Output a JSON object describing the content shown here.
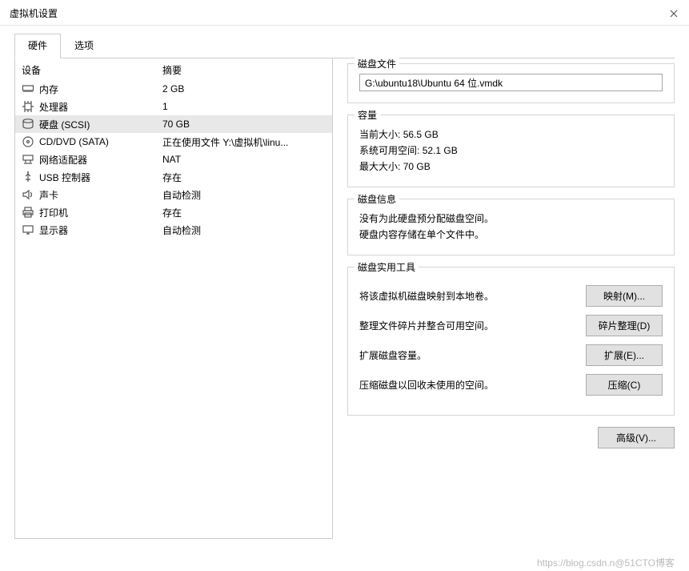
{
  "title": "虚拟机设置",
  "tabs": {
    "hardware": "硬件",
    "options": "选项"
  },
  "hwHeader": {
    "device": "设备",
    "summary": "摘要"
  },
  "hwItems": [
    {
      "icon": "memory",
      "name": "内存",
      "summary": "2 GB"
    },
    {
      "icon": "cpu",
      "name": "处理器",
      "summary": "1"
    },
    {
      "icon": "disk",
      "name": "硬盘 (SCSI)",
      "summary": "70 GB"
    },
    {
      "icon": "disc",
      "name": "CD/DVD (SATA)",
      "summary": "正在使用文件 Y:\\虚拟机\\linu..."
    },
    {
      "icon": "net",
      "name": "网络适配器",
      "summary": "NAT"
    },
    {
      "icon": "usb",
      "name": "USB 控制器",
      "summary": "存在"
    },
    {
      "icon": "sound",
      "name": "声卡",
      "summary": "自动检测"
    },
    {
      "icon": "printer",
      "name": "打印机",
      "summary": "存在"
    },
    {
      "icon": "display",
      "name": "显示器",
      "summary": "自动检测"
    }
  ],
  "diskFile": {
    "legend": "磁盘文件",
    "value": "G:\\ubuntu18\\Ubuntu 64 位.vmdk"
  },
  "capacity": {
    "legend": "容量",
    "currentLabel": "当前大小:",
    "currentValue": "56.5 GB",
    "freeLabel": "系统可用空间:",
    "freeValue": "52.1 GB",
    "maxLabel": "最大大小:",
    "maxValue": "70 GB"
  },
  "diskInfo": {
    "legend": "磁盘信息",
    "line1": "没有为此硬盘预分配磁盘空间。",
    "line2": "硬盘内容存储在单个文件中。"
  },
  "utilities": {
    "legend": "磁盘实用工具",
    "mapDesc": "将该虚拟机磁盘映射到本地卷。",
    "mapBtn": "映射(M)...",
    "defragDesc": "整理文件碎片并整合可用空间。",
    "defragBtn": "碎片整理(D)",
    "expandDesc": "扩展磁盘容量。",
    "expandBtn": "扩展(E)...",
    "compactDesc": "压缩磁盘以回收未使用的空间。",
    "compactBtn": "压缩(C)"
  },
  "advancedBtn": "高级(V)...",
  "watermark": "https://blog.csdn.n@51CTO博客"
}
